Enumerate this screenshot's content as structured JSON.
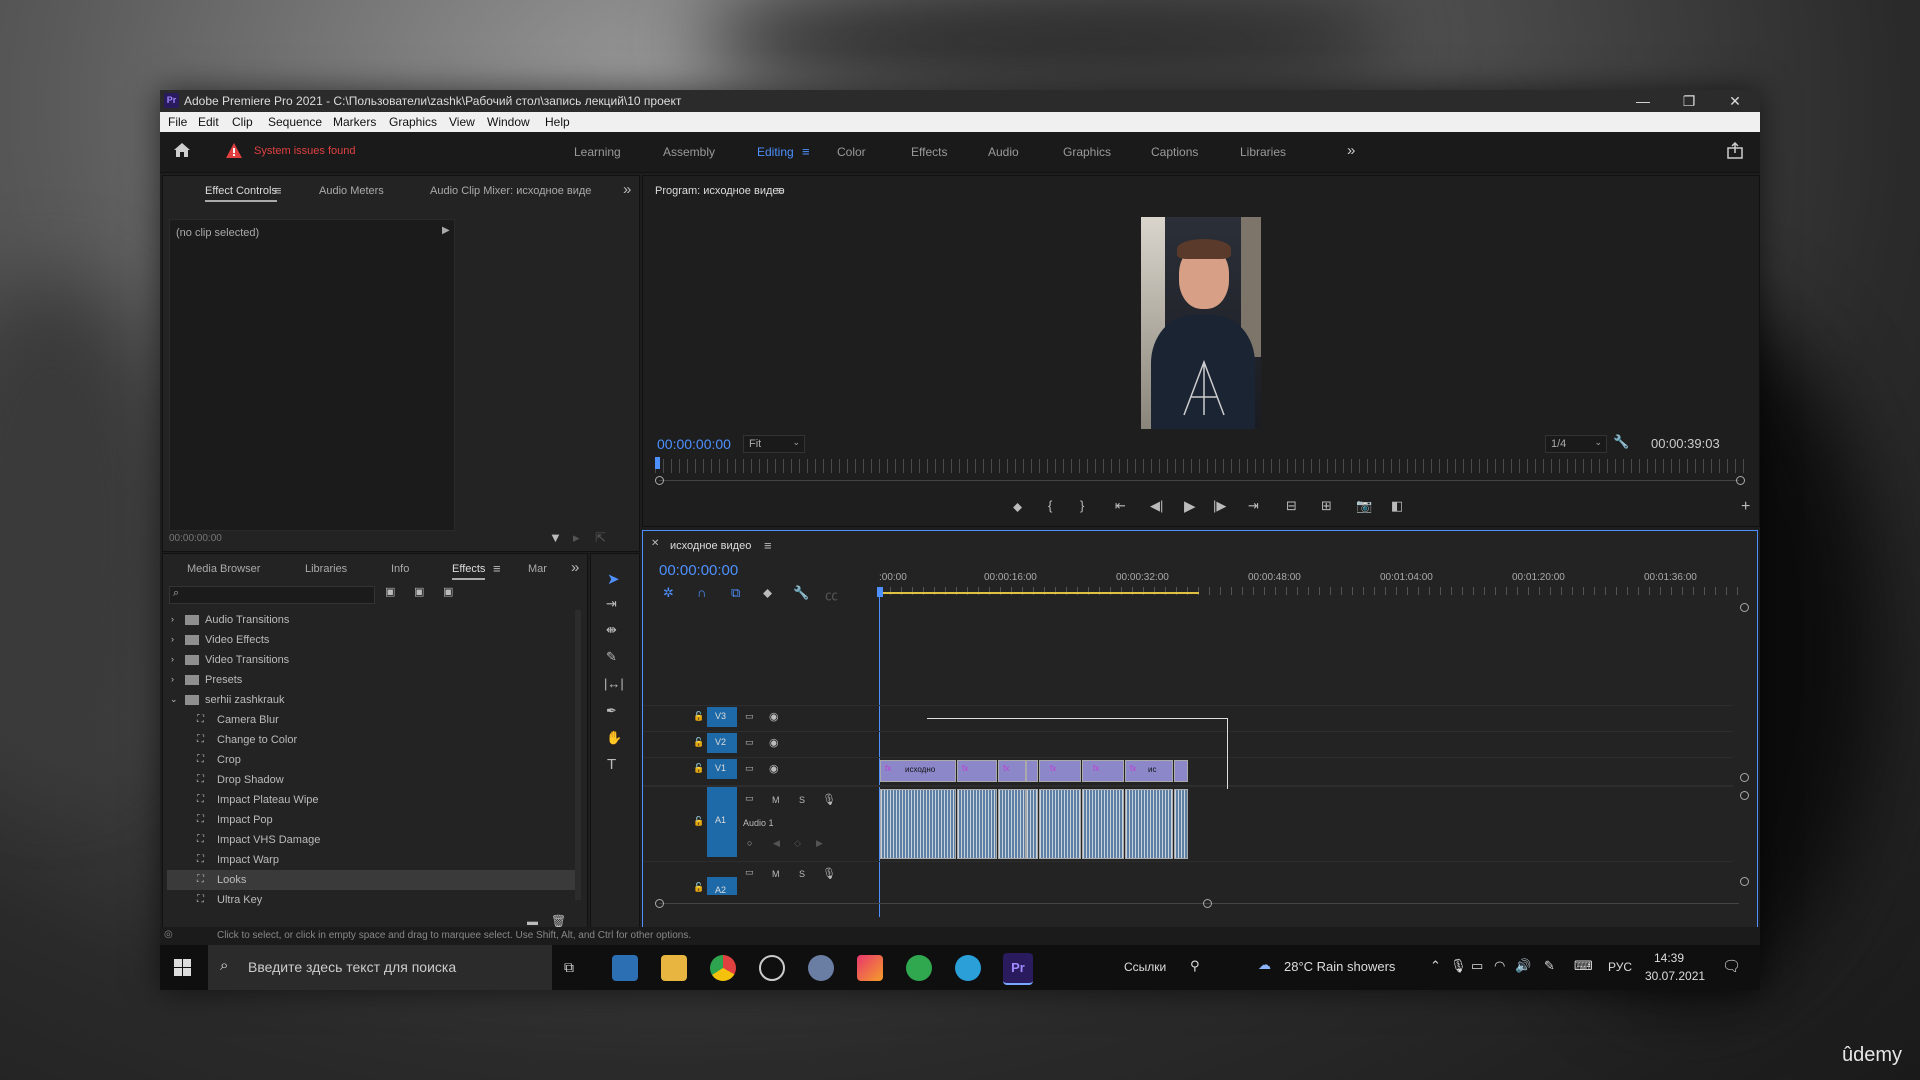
{
  "window": {
    "title": "Adobe Premiere Pro 2021 - C:\\Пользователи\\zashk\\Рабочий стол\\запись лекций\\10 проект",
    "app_icon": "Pr",
    "controls": {
      "minimize": "—",
      "restore": "❐",
      "close": "✕"
    }
  },
  "menu": [
    "File",
    "Edit",
    "Clip",
    "Sequence",
    "Markers",
    "Graphics",
    "View",
    "Window",
    "Help"
  ],
  "workspace_bar": {
    "home_icon": "home-icon",
    "warning": "System issues found",
    "workspaces": [
      "Learning",
      "Assembly",
      "Editing",
      "Color",
      "Effects",
      "Audio",
      "Graphics",
      "Captions",
      "Libraries"
    ],
    "active": "Editing",
    "more": "»",
    "share_icon": "share-icon"
  },
  "source_panel": {
    "tabs": [
      "Effect Controls",
      "Audio Meters",
      "Audio Clip Mixer: исходное виде"
    ],
    "active_tab": "Effect Controls",
    "no_clip": "(no clip selected)",
    "timecode": "00:00:00:00",
    "more": "»"
  },
  "program_monitor": {
    "title": "Program: исходное видео",
    "timecode": "00:00:00:00",
    "fit": "Fit",
    "resolution": "1/4",
    "duration": "00:00:39:03"
  },
  "project_panel": {
    "tabs": [
      "Media Browser",
      "Libraries",
      "Info",
      "Effects",
      "Mar"
    ],
    "active_tab": "Effects",
    "more": "»",
    "folders": [
      {
        "label": "Audio Transitions",
        "expanded": false
      },
      {
        "label": "Video Effects",
        "expanded": false
      },
      {
        "label": "Video Transitions",
        "expanded": false
      },
      {
        "label": "Presets",
        "expanded": false
      },
      {
        "label": "serhii zashkrauk",
        "expanded": true
      }
    ],
    "presets": [
      "Camera Blur",
      "Change to Color",
      "Crop",
      "Drop Shadow",
      "Impact Plateau Wipe",
      "Impact Pop",
      "Impact VHS Damage",
      "Impact Warp",
      "Looks",
      "Ultra Key"
    ],
    "selected": "Looks"
  },
  "timeline": {
    "sequence_name": "исходное видео",
    "timecode": "00:00:00:00",
    "ruler": [
      ":00:00",
      "00:00:16:00",
      "00:00:32:00",
      "00:00:48:00",
      "00:01:04:00",
      "00:01:20:00",
      "00:01:36:00"
    ],
    "tracks": {
      "video": [
        "V3",
        "V2",
        "V1"
      ],
      "audio": [
        "A1",
        "A2"
      ],
      "audio1_name": "Audio 1",
      "m": "M",
      "s": "S"
    },
    "clip_labels": [
      "исходно",
      "ис"
    ]
  },
  "status_bar": "Click to select, or click in empty space and drag to marquee select. Use Shift, Alt, and Ctrl for other options.",
  "taskbar": {
    "search_placeholder": "Введите здесь текст для поиска",
    "links": "Ссылки",
    "weather": "28°C  Rain showers",
    "lang": "РУС",
    "time": "14:39",
    "date": "30.07.2021"
  },
  "watermark": "ûdemy",
  "colors": {
    "accent": "#4d90fe",
    "warning": "#e04040",
    "track_blue": "#1e6aa8",
    "clip_video": "#8b87c9",
    "clip_audio": "#5c7fa3",
    "playhead": "#4d90fe",
    "work_area": "#e0c040"
  }
}
